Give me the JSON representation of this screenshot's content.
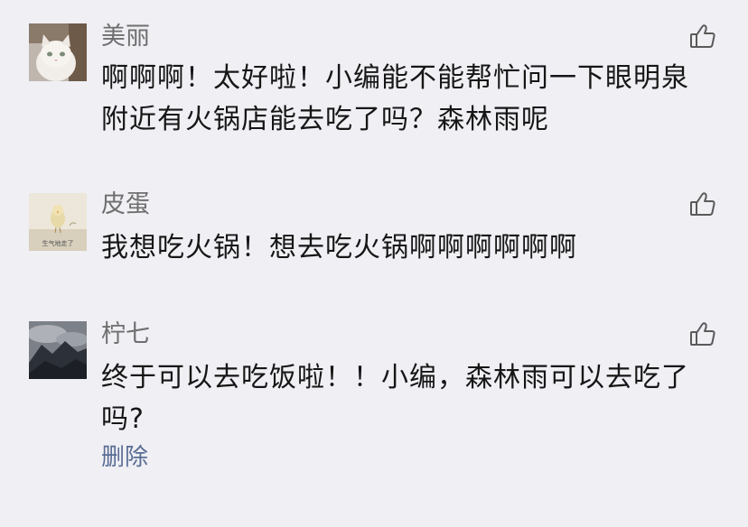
{
  "comments": [
    {
      "nickname": "美丽",
      "text": "啊啊啊！太好啦！小编能不能帮忙问一下眼明泉附近有火锅店能去吃了吗？森林雨呢",
      "avatar": "cat-photo"
    },
    {
      "nickname": "皮蛋",
      "text": "我想吃火锅！想去吃火锅啊啊啊啊啊啊",
      "avatar": "chick-sticker",
      "avatar_caption": "生气地走了"
    },
    {
      "nickname": "柠七",
      "text": "终于可以去吃饭啦！！小编，森林雨可以去吃了吗?",
      "avatar": "mountain-photo",
      "delete_label": "删除"
    }
  ],
  "icons": {
    "like": "thumbs-up-icon"
  },
  "colors": {
    "background": "#efeff4",
    "nickname": "#6f6f6f",
    "text": "#161616",
    "link": "#5a6d94"
  }
}
